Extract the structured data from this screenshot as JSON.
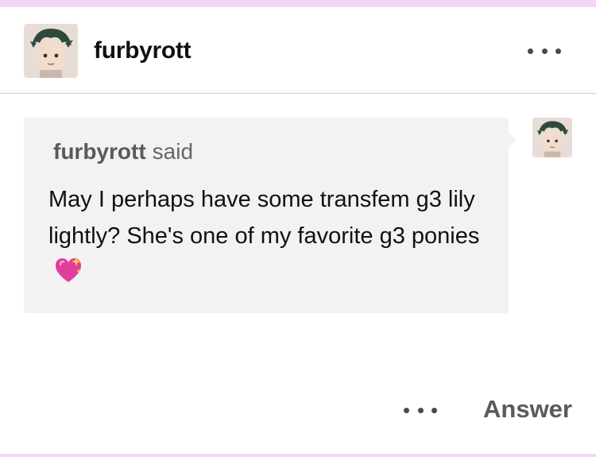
{
  "post": {
    "blog_name": "furbyrott",
    "more_icon": "ellipsis-icon"
  },
  "ask": {
    "asker_name": "furbyrott",
    "said_label": "said",
    "question_text": "May I perhaps have some transfem g3 lily lightly? She's one of my favorite g3 ponies",
    "emoji": "sparkling-heart-icon"
  },
  "footer": {
    "more_icon": "ellipsis-icon",
    "answer_label": "Answer"
  },
  "colors": {
    "accent_pink": "#f3d6f5",
    "bubble_bg": "#f2f2f2",
    "heart": "#e23d9b"
  }
}
